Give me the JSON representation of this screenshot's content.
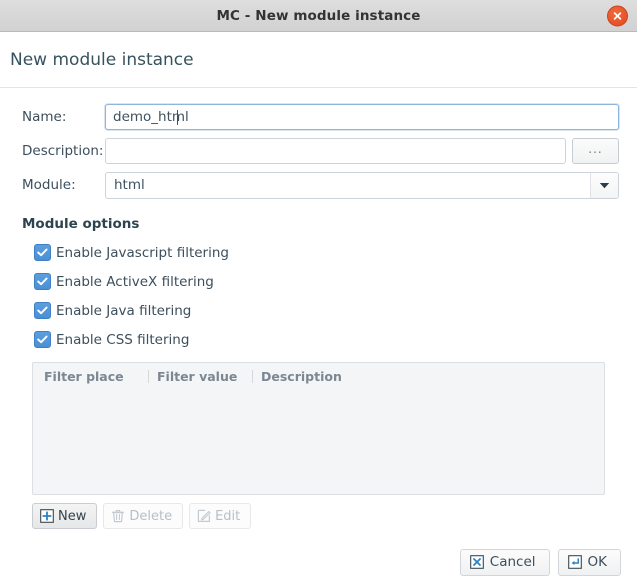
{
  "window": {
    "title": "MC - New module instance",
    "close_icon": "close-icon",
    "close_color": "#e7552a"
  },
  "heading": {
    "text": "New module instance"
  },
  "form": {
    "name": {
      "label": "Name:",
      "value": "demo_html",
      "placeholder": "",
      "focused": true
    },
    "description": {
      "label": "Description:",
      "value": "",
      "placeholder": "",
      "browse_label": "...",
      "browse_icon": "ellipsis-icon"
    },
    "module": {
      "label": "Module:",
      "value": "html",
      "arrow_icon": "chevron-down-icon"
    }
  },
  "module_options": {
    "title": "Module options",
    "checkbox_color": "#4a8fd4",
    "items": [
      {
        "label": "Enable Javascript filtering",
        "checked": true
      },
      {
        "label": "Enable ActiveX filtering",
        "checked": true
      },
      {
        "label": "Enable Java filtering",
        "checked": true
      },
      {
        "label": "Enable CSS filtering",
        "checked": true
      }
    ]
  },
  "filter_table": {
    "columns": [
      "Filter place",
      "Filter value",
      "Description"
    ],
    "rows": []
  },
  "table_actions": [
    {
      "label": "New",
      "icon": "plus-box-icon",
      "enabled": true
    },
    {
      "label": "Delete",
      "icon": "trash-icon",
      "enabled": false
    },
    {
      "label": "Edit",
      "icon": "pencil-icon",
      "enabled": false
    }
  ],
  "dialog_buttons": [
    {
      "label": "Cancel",
      "icon": "cancel-x-icon"
    },
    {
      "label": "OK",
      "icon": "enter-key-icon"
    }
  ]
}
